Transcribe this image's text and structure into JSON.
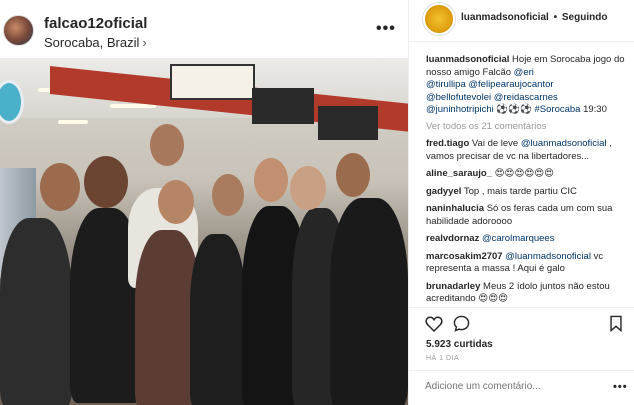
{
  "post": {
    "username": "falcao12oficial",
    "location": "Sorocaba, Brazil",
    "location_chevron": "›",
    "more": "•••"
  },
  "sidebar": {
    "username": "luanmadsonoficial",
    "separator": "•",
    "follow_label": "Seguindo",
    "caption": {
      "user": "luanmadsonoficial",
      "text_1": " Hoje em Sorocaba jogo do nosso amigo Falcão ",
      "mention_1": "@eri",
      "line2": "@tirullipa",
      "mention_3": "@felipearaujocantor",
      "mention_4": "@bellofutevolei",
      "mention_5": "@reidascarnes",
      "mention_6": "@juninhotripichi",
      "text_tail": " ⚽⚽⚽ ",
      "hashtag": "#Sorocaba",
      "time_text": " 19:30"
    },
    "view_all": "Ver todos os 21 comentários",
    "comments": [
      {
        "user": "fred.tiago",
        "text": " Vai de leve ",
        "mention": "@luanmadsonoficial",
        "tail": " , vamos precisar de vc na libertadores..."
      },
      {
        "user": "aline_saraujo_",
        "text": " 😍😍😍😍😍😍",
        "mention": "",
        "tail": ""
      },
      {
        "user": "gadyyel",
        "text": " Top , mais tarde partiu CIC",
        "mention": "",
        "tail": ""
      },
      {
        "user": "naninhalucia",
        "text": " Só os feras cada um com sua habilidade adoroooo",
        "mention": "",
        "tail": ""
      },
      {
        "user": "realvdornaz",
        "text": " ",
        "mention": "@carolmarquees",
        "tail": ""
      },
      {
        "user": "marcosakim2707",
        "text": " ",
        "mention": "@luanmadsonoficial",
        "tail": " vc representa a massa ! Aqui é galo"
      },
      {
        "user": "brunadarley",
        "text": " Meus 2 ídolo juntos não estou acreditando 😍😍😍",
        "mention": "",
        "tail": ""
      }
    ],
    "likes": "5.923 curtidas",
    "time": "HÁ 1 DIA",
    "add_comment_placeholder": "Adicione um comentário...",
    "more": "•••"
  },
  "icons": {
    "heart": "heart-icon",
    "comment": "comment-icon",
    "bookmark": "bookmark-icon"
  },
  "colors": {
    "mention": "#003569",
    "muted": "#999999",
    "text": "#262626"
  }
}
